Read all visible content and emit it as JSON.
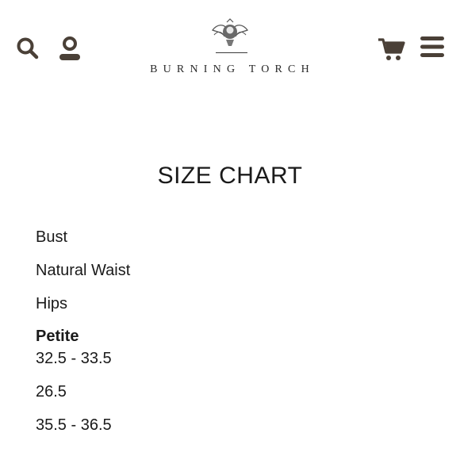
{
  "header": {
    "brand_name": "BURNING TORCH",
    "icons": {
      "search": "search-icon",
      "account": "account-icon",
      "cart": "cart-icon",
      "menu": "hamburger-menu-icon",
      "logo_emblem": "winged-torch-emblem"
    },
    "icon_color": "#4a4037"
  },
  "main": {
    "title": "SIZE CHART",
    "measurements": [
      "Bust",
      "Natural Waist",
      "Hips"
    ],
    "size_column": {
      "label": "Petite",
      "values": [
        "32.5 - 33.5",
        "26.5",
        "35.5 - 36.5"
      ]
    }
  }
}
